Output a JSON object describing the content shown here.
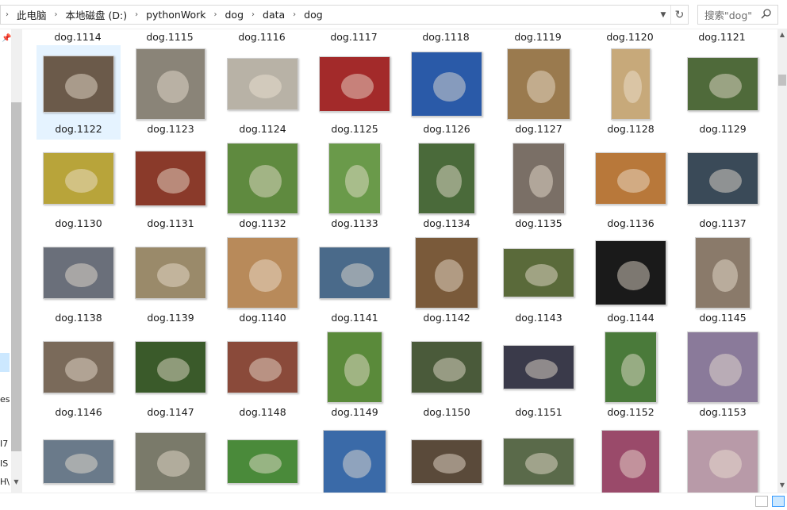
{
  "breadcrumb": [
    "此电脑",
    "本地磁盘 (D:)",
    "pythonWork",
    "dog",
    "data",
    "dog"
  ],
  "search": {
    "placeholder": "搜索\"dog\""
  },
  "nav_fragments": [
    "es",
    "I7",
    "IS",
    "H\\"
  ],
  "top_row_labels": [
    "dog.1114",
    "dog.1115",
    "dog.1116",
    "dog.1117",
    "dog.1118",
    "dog.1119",
    "dog.1120",
    "dog.1121"
  ],
  "files": [
    {
      "name": "dog.1122",
      "color": "#6b5a4a",
      "selected": true
    },
    {
      "name": "dog.1123",
      "color": "#8a8478"
    },
    {
      "name": "dog.1124",
      "color": "#b8b2a6"
    },
    {
      "name": "dog.1125",
      "color": "#a32a2a"
    },
    {
      "name": "dog.1126",
      "color": "#2a5aa8"
    },
    {
      "name": "dog.1127",
      "color": "#9a7a4e"
    },
    {
      "name": "dog.1128",
      "color": "#c7a97a"
    },
    {
      "name": "dog.1129",
      "color": "#4f6a3a"
    },
    {
      "name": "dog.1130",
      "color": "#b8a43a"
    },
    {
      "name": "dog.1131",
      "color": "#8a3a2a"
    },
    {
      "name": "dog.1132",
      "color": "#5f8a3f"
    },
    {
      "name": "dog.1133",
      "color": "#6a9a4a"
    },
    {
      "name": "dog.1134",
      "color": "#4a6a3a"
    },
    {
      "name": "dog.1135",
      "color": "#7a6f66"
    },
    {
      "name": "dog.1136",
      "color": "#b8783a"
    },
    {
      "name": "dog.1137",
      "color": "#3a4a58"
    },
    {
      "name": "dog.1138",
      "color": "#6a6f7a"
    },
    {
      "name": "dog.1139",
      "color": "#9a8a6a"
    },
    {
      "name": "dog.1140",
      "color": "#b88a5a"
    },
    {
      "name": "dog.1141",
      "color": "#4a6a8a"
    },
    {
      "name": "dog.1142",
      "color": "#7a5a3a"
    },
    {
      "name": "dog.1143",
      "color": "#5a6a3a"
    },
    {
      "name": "dog.1144",
      "color": "#1a1a1a"
    },
    {
      "name": "dog.1145",
      "color": "#8a7a6a"
    },
    {
      "name": "dog.1146",
      "color": "#7a6a5a"
    },
    {
      "name": "dog.1147",
      "color": "#3a5a2a"
    },
    {
      "name": "dog.1148",
      "color": "#8a4a3a"
    },
    {
      "name": "dog.1149",
      "color": "#5a8a3a"
    },
    {
      "name": "dog.1150",
      "color": "#4a5a3a"
    },
    {
      "name": "dog.1151",
      "color": "#3a3a4a"
    },
    {
      "name": "dog.1152",
      "color": "#4a7a3a"
    },
    {
      "name": "dog.1153",
      "color": "#8a7a9a"
    },
    {
      "name": "",
      "color": "#6a7a8a"
    },
    {
      "name": "",
      "color": "#7a7a6a"
    },
    {
      "name": "",
      "color": "#4a8a3a"
    },
    {
      "name": "",
      "color": "#3a6aa8"
    },
    {
      "name": "",
      "color": "#5a4a3a"
    },
    {
      "name": "",
      "color": "#5a6a4a"
    },
    {
      "name": "",
      "color": "#9a4a6a"
    },
    {
      "name": "",
      "color": "#b89aa8"
    }
  ]
}
